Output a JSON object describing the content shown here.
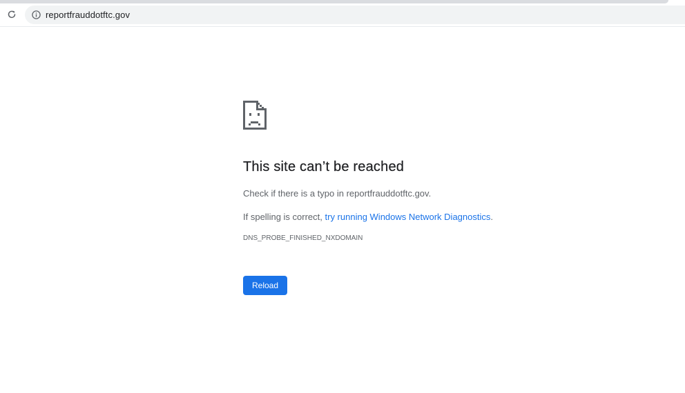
{
  "browser": {
    "url": "reportfrauddotftc.gov",
    "reload_icon": "reload-icon",
    "site_info_icon": "info-icon"
  },
  "error_page": {
    "icon": "sad-page-icon",
    "title": "This site can’t be reached",
    "check_text": "Check if there is a typo in reportfrauddotftc.gov.",
    "spelling_prefix": "If spelling is correct, ",
    "diagnostics_link": "try running Windows Network Diagnostics",
    "spelling_suffix": ".",
    "error_code": "DNS_PROBE_FINISHED_NXDOMAIN",
    "reload_label": "Reload"
  },
  "colors": {
    "accent": "#1a73e8",
    "text_primary": "#202124",
    "text_secondary": "#5f6368",
    "omnibox_bg": "#f1f3f4"
  }
}
